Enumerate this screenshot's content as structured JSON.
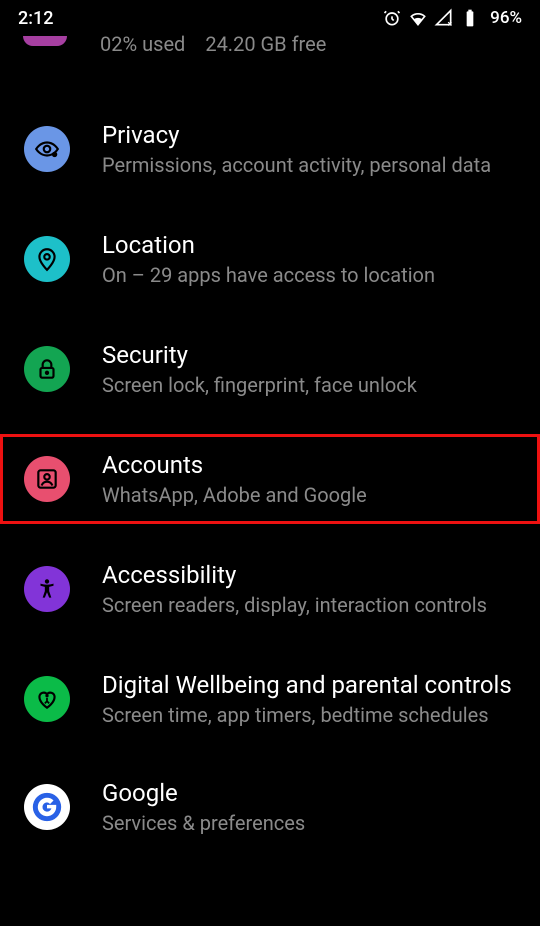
{
  "status_bar": {
    "time": "2:12",
    "battery": "96%"
  },
  "cutoff": {
    "left": "02% used",
    "right": "24.20 GB free"
  },
  "items": [
    {
      "title": "Privacy",
      "subtitle": "Permissions, account activity, personal data",
      "icon_bg": "#6a96e6",
      "icon": "eye-lock",
      "highlighted": false
    },
    {
      "title": "Location",
      "subtitle": "On – 29 apps have access to location",
      "icon_bg": "#1dc0c9",
      "icon": "pin",
      "highlighted": false
    },
    {
      "title": "Security",
      "subtitle": "Screen lock, fingerprint, face unlock",
      "icon_bg": "#13a552",
      "icon": "lock",
      "highlighted": false
    },
    {
      "title": "Accounts",
      "subtitle": "WhatsApp, Adobe and Google",
      "icon_bg": "#e84f6f",
      "icon": "account-box",
      "highlighted": true
    },
    {
      "title": "Accessibility",
      "subtitle": "Screen readers, display, interaction controls",
      "icon_bg": "#8234d8",
      "icon": "accessibility",
      "highlighted": false
    },
    {
      "title": "Digital Wellbeing and parental controls",
      "subtitle": "Screen time, app timers, bedtime schedules",
      "icon_bg": "#0bbb48",
      "icon": "heart-person",
      "highlighted": false
    },
    {
      "title": "Google",
      "subtitle": "Services & preferences",
      "icon_bg": "#ffffff",
      "icon": "google-g",
      "highlighted": false
    }
  ]
}
